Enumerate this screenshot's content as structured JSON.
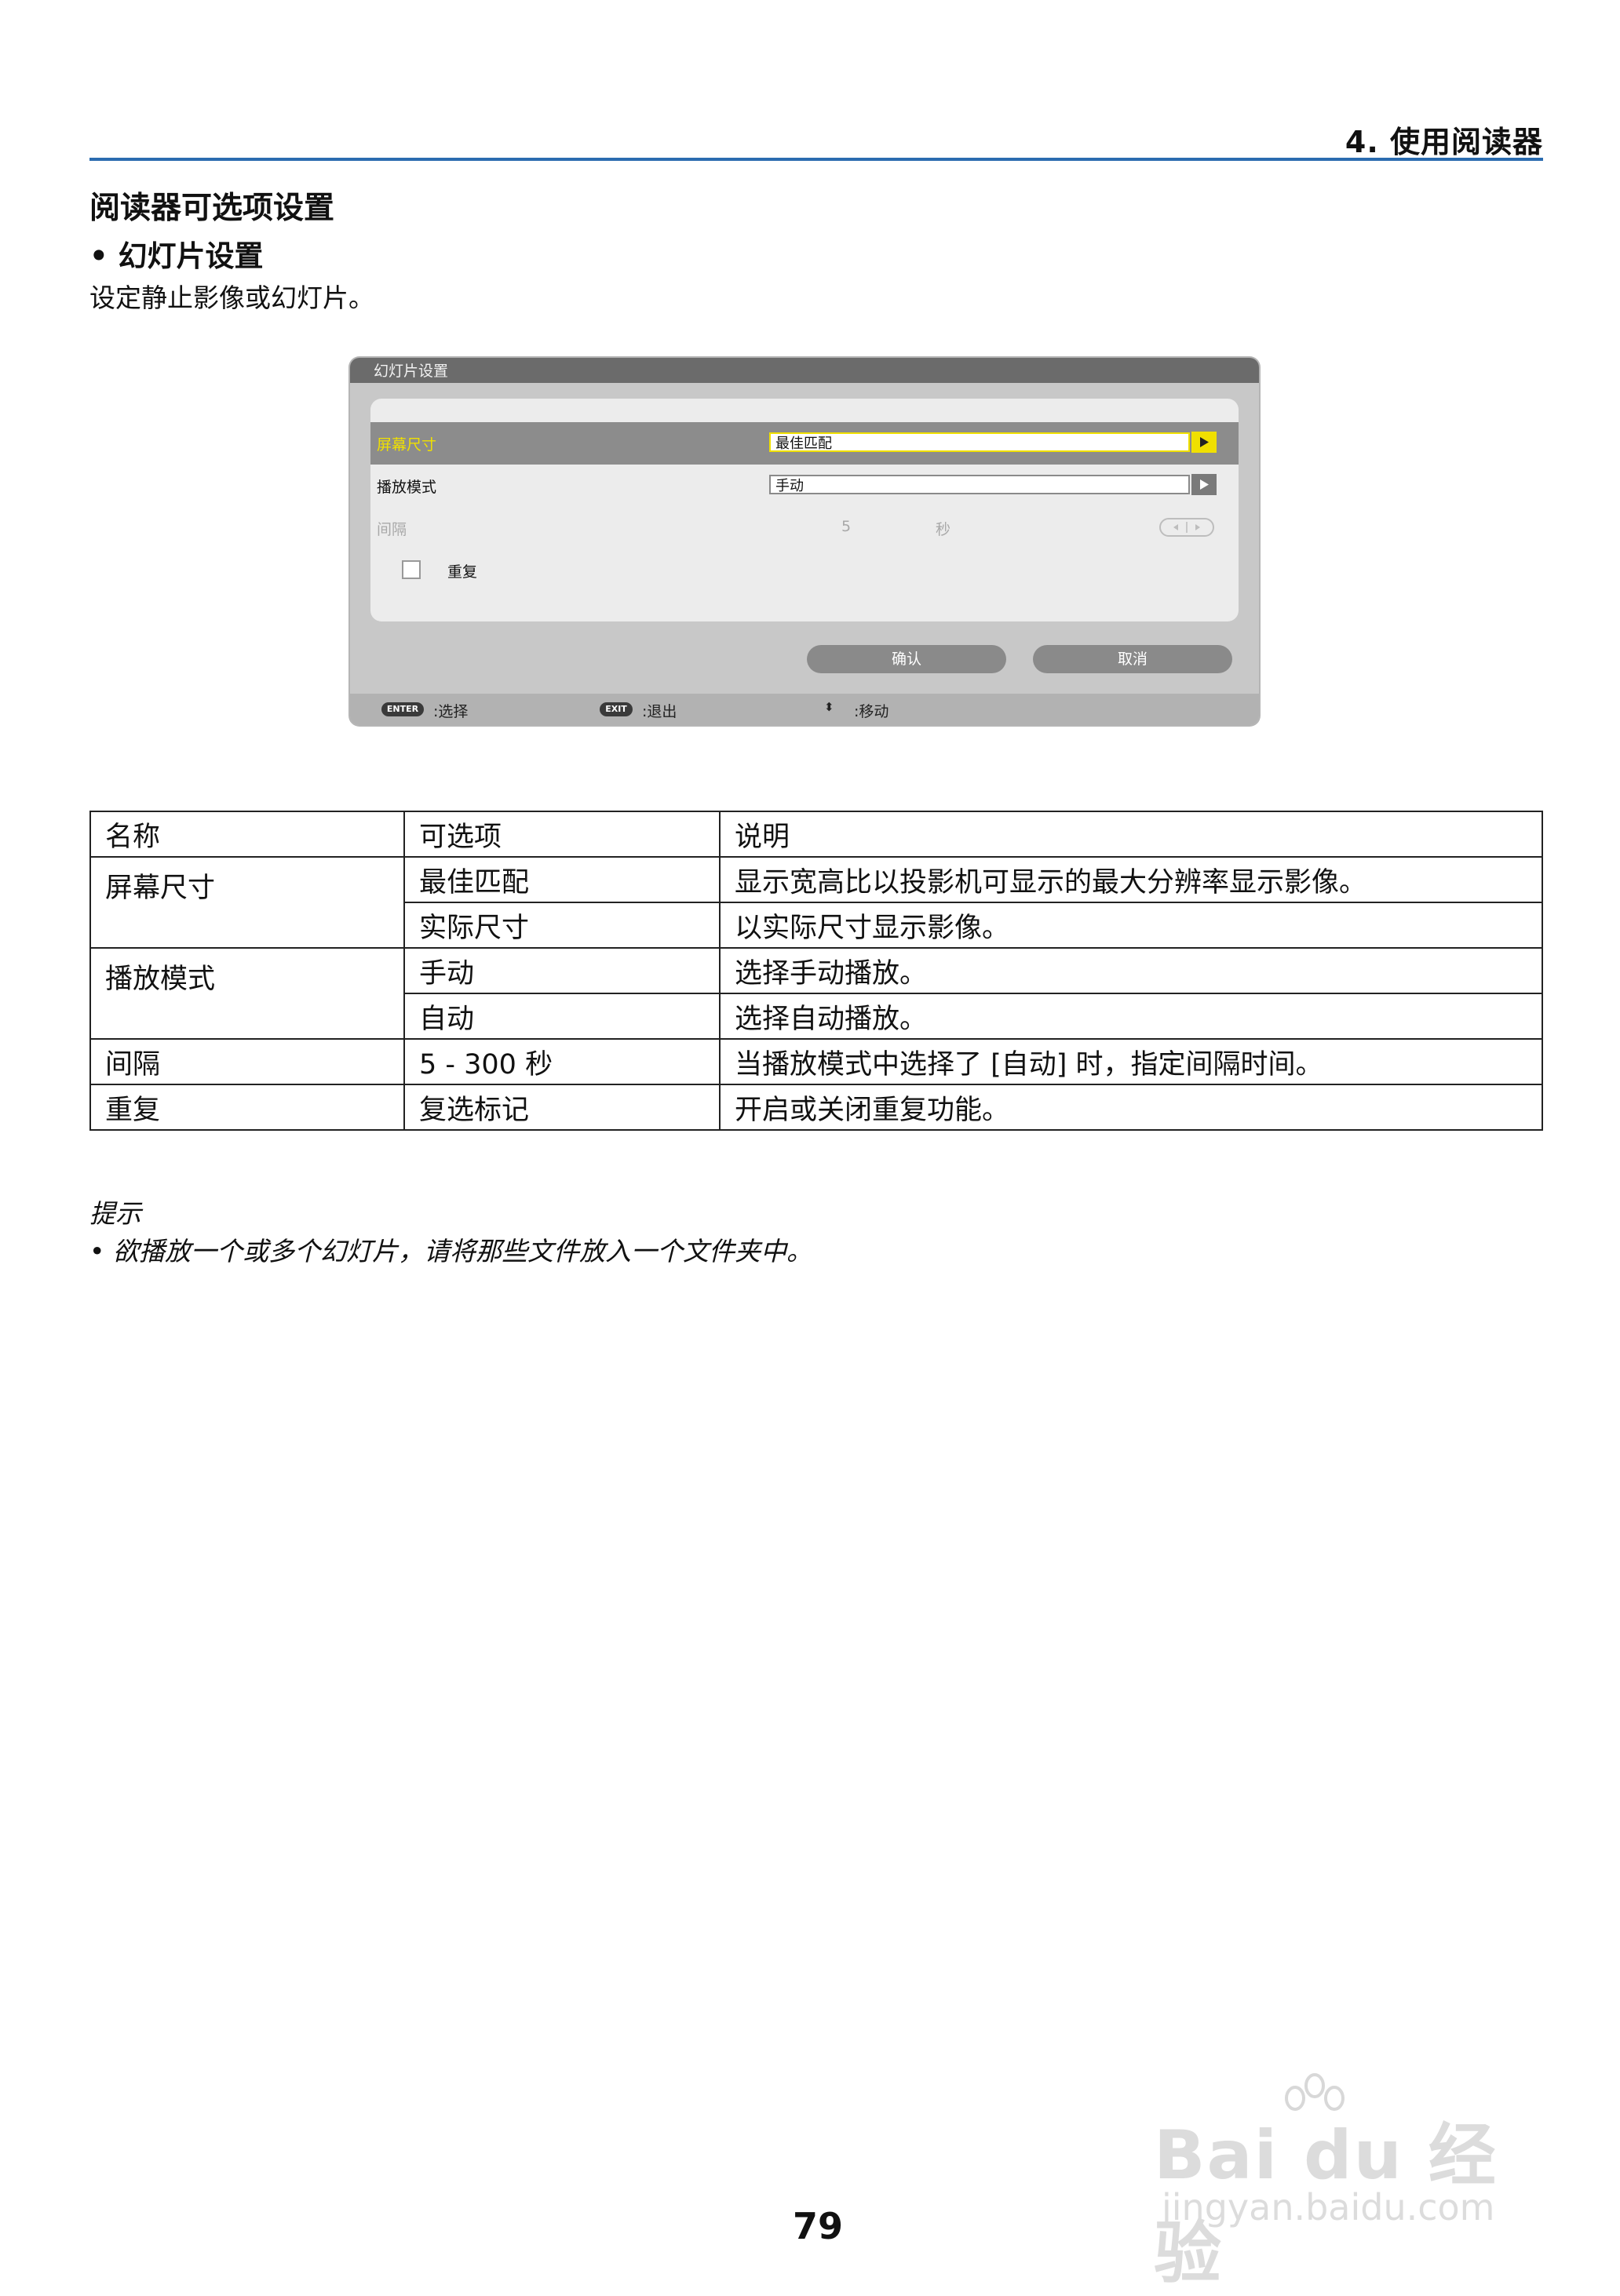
{
  "header": {
    "chapter": "4. 使用阅读器"
  },
  "section_title": "阅读器可选项设置",
  "bullet_title": "• 幻灯片设置",
  "intro": "设定静止影像或幻灯片。",
  "dialog": {
    "title": "幻灯片设置",
    "rows": [
      {
        "label": "屏幕尺寸",
        "value": "最佳匹配"
      },
      {
        "label": "播放模式",
        "value": "手动"
      }
    ],
    "interval": {
      "label": "间隔",
      "value": "5",
      "unit": "秒"
    },
    "repeat_label": "重复",
    "ok_label": "确认",
    "cancel_label": "取消",
    "footer": {
      "enter_key": "ENTER",
      "enter_text": ":选择",
      "exit_key": "EXIT",
      "exit_text": ":退出",
      "move_symbol": "⬍",
      "move_text": ":移动"
    },
    "colors": {
      "highlight": "#f0e000",
      "bar": "#6b6b6b"
    }
  },
  "table": {
    "headers": [
      "名称",
      "可选项",
      "说明"
    ],
    "rows": [
      [
        "屏幕尺寸",
        "最佳匹配",
        "显示宽高比以投影机可显示的最大分辨率显示影像。"
      ],
      [
        "",
        "实际尺寸",
        "以实际尺寸显示影像。"
      ],
      [
        "播放模式",
        "手动",
        "选择手动播放。"
      ],
      [
        "",
        "自动",
        "选择自动播放。"
      ],
      [
        "间隔",
        "5 - 300 秒",
        "当播放模式中选择了 [自动] 时，指定间隔时间。"
      ],
      [
        "重复",
        "复选标记",
        "开启或关闭重复功能。"
      ]
    ]
  },
  "hint": {
    "title": "提示",
    "item": "• 欲播放一个或多个幻灯片，请将那些文件放入一个文件夹中。"
  },
  "page_number": "79",
  "watermark": {
    "logo": "Bai du 经验",
    "url": "jingyan.baidu.com"
  }
}
